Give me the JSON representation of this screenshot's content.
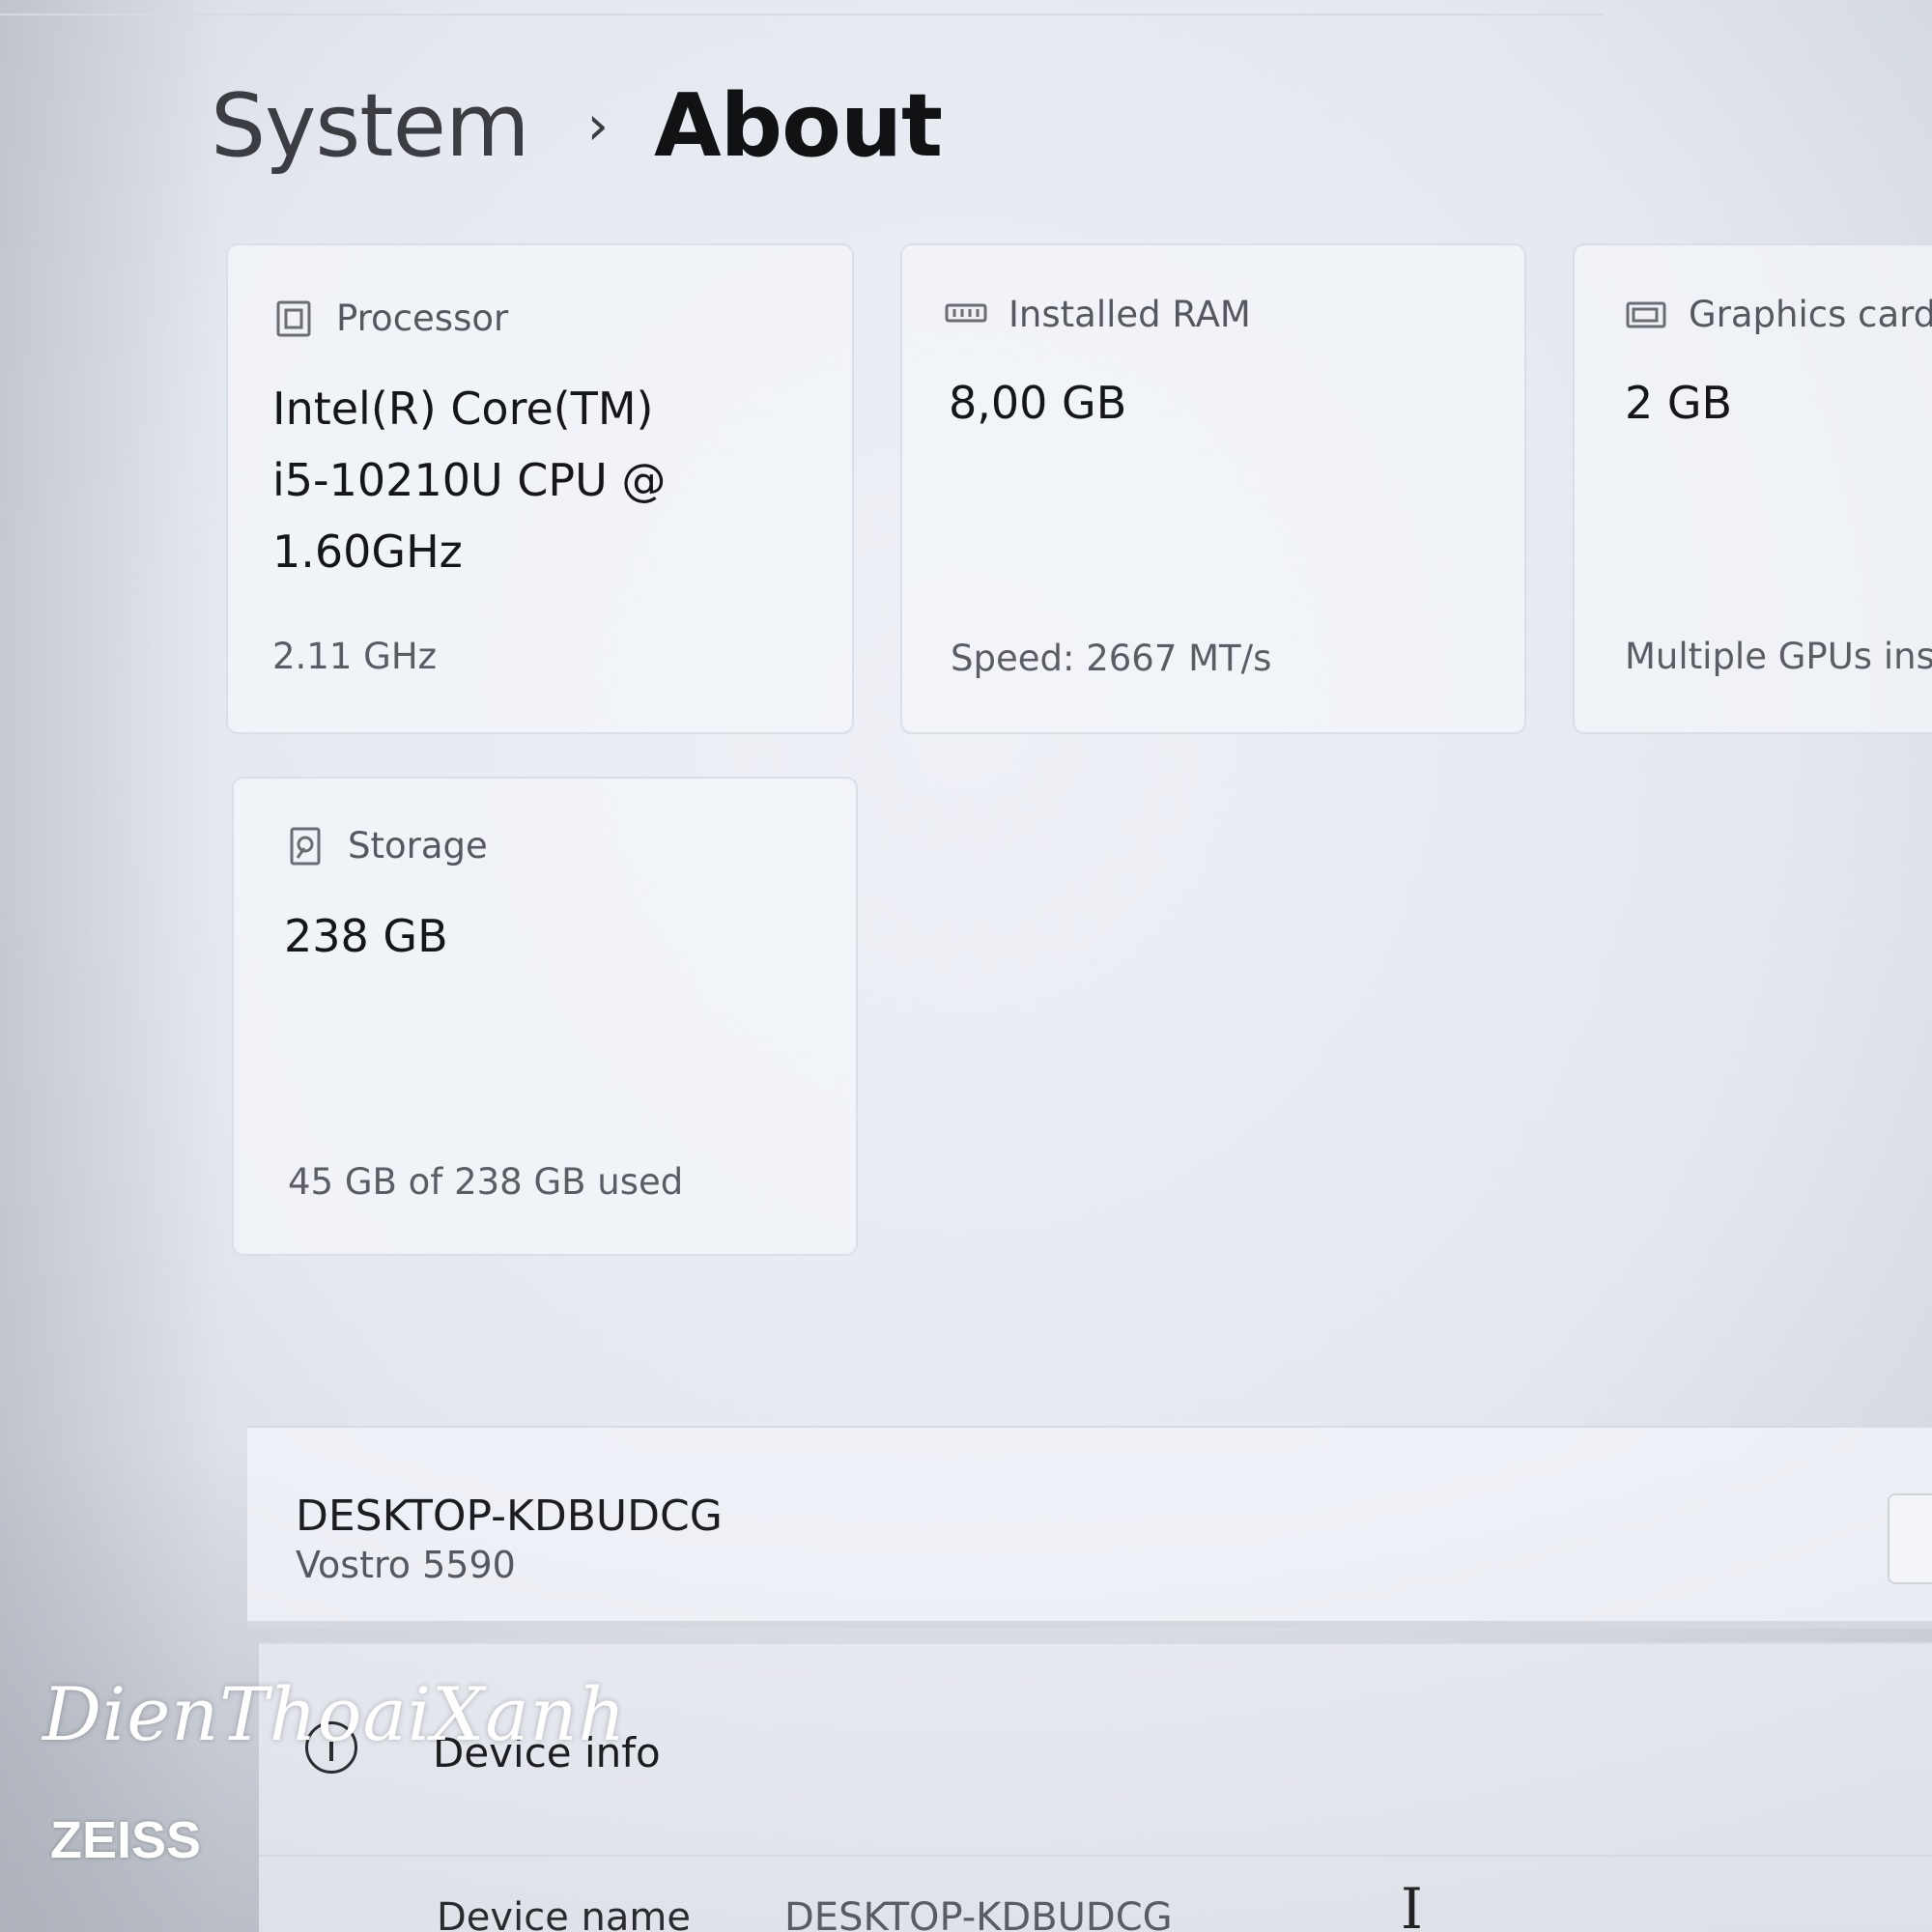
{
  "breadcrumb": {
    "parent": "System",
    "separator": "›",
    "current": "About"
  },
  "specs": {
    "processor": {
      "label": "Processor",
      "icon": "processor-icon",
      "value_lines": [
        "Intel(R) Core(TM)",
        "i5-10210U CPU @",
        "1.60GHz"
      ],
      "sub": "2.11 GHz"
    },
    "ram": {
      "label": "Installed RAM",
      "icon": "ram-icon",
      "value": "8,00 GB",
      "sub": "Speed: 2667 MT/s"
    },
    "graphics": {
      "label": "Graphics card",
      "icon": "graphics-card-icon",
      "value": "2 GB",
      "sub": "Multiple GPUs inst"
    },
    "storage": {
      "label": "Storage",
      "icon": "storage-icon",
      "value": "238 GB",
      "sub": "45 GB of 238 GB used",
      "used_fraction": 0.189
    }
  },
  "device": {
    "name": "DESKTOP-KDBUDCG",
    "model": "Vostro 5590"
  },
  "device_info": {
    "title": "Device info",
    "icon": "info-icon",
    "rows": [
      {
        "label": "Device name",
        "value": "DESKTOP-KDBUDCG"
      }
    ]
  },
  "overlay": {
    "watermark": "DienThoaiXanh",
    "brand": "ZEISS"
  },
  "colors": {
    "background": "#e8ebf2",
    "card": "#f3f5fa",
    "text": "#1a1a1a",
    "secondary_text": "#5a5d63"
  }
}
